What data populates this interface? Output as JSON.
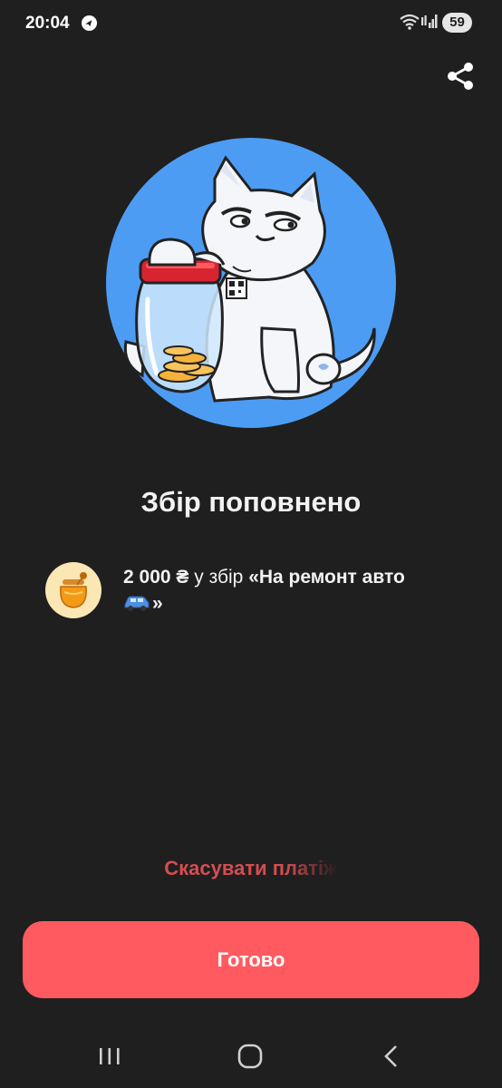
{
  "status_bar": {
    "time": "20:04",
    "battery": "59",
    "icons": [
      "notification-app-icon",
      "wifi-icon",
      "signal-icon",
      "battery-icon"
    ]
  },
  "header": {
    "share_icon": "share-icon"
  },
  "hero": {
    "image": "cat-with-coin-jar-illustration",
    "circle_color": "#4d9cf3"
  },
  "title": "Збір поповнено",
  "donation": {
    "avatar_icon": "honey-jar-icon",
    "amount": "2 000 ₴",
    "preposition": " у збір ",
    "jar_name": "«На ремонт авто",
    "car_emoji_icon": "blue-car-icon",
    "jar_name_end": "»"
  },
  "cancel_label": "Скасувати платіж",
  "done_label": "Готово",
  "nav_bar": {
    "recent_icon": "recent-apps-icon",
    "home_icon": "home-icon",
    "back_icon": "back-icon"
  },
  "colors": {
    "background": "#1f1f1f",
    "accent": "#ff5a60",
    "cancel_text": "#d64d51",
    "hero_circle": "#4d9cf3",
    "avatar_bg": "#fbe7b4"
  }
}
